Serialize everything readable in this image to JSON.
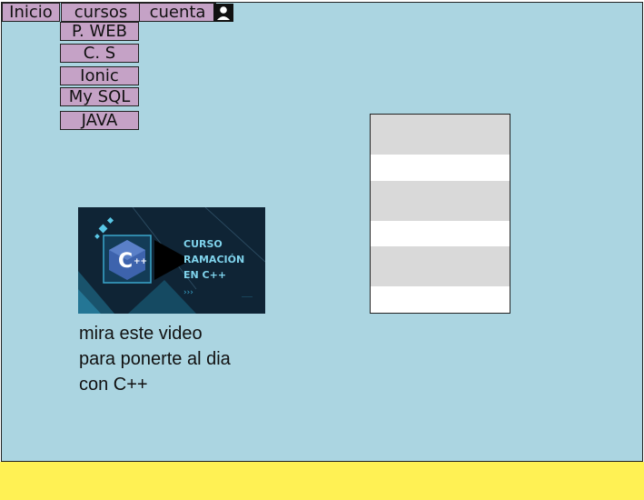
{
  "nav": {
    "items": [
      {
        "label": "Inicio"
      },
      {
        "label": "cursos"
      },
      {
        "label": "cuenta"
      }
    ]
  },
  "cursos_menu": {
    "items": [
      {
        "label": "P. WEB"
      },
      {
        "label": "C. S"
      },
      {
        "label": "Ionic"
      },
      {
        "label": "My SQL"
      },
      {
        "label": "JAVA"
      }
    ]
  },
  "video": {
    "line1": "CURSO",
    "line2": "RAMACIÓN",
    "line3": "EN C++",
    "logo_letter": "C",
    "logo_marks": "++"
  },
  "caption": {
    "line1": "mira este video",
    "line2": "para ponerte al dia",
    "line3": "con C++"
  },
  "table": {
    "rows": [
      {
        "shade": "#d9d9d9"
      },
      {
        "shade": "#ffffff"
      },
      {
        "shade": "#d9d9d9"
      },
      {
        "shade": "#ffffff"
      },
      {
        "shade": "#d9d9d9"
      },
      {
        "shade": "#ffffff"
      }
    ]
  },
  "colors": {
    "background": "#abd5e1",
    "menu": "#c5a2c6",
    "footer": "#fff154",
    "video_bg": "#0f2435",
    "video_accent": "#1d8cb0"
  },
  "icons": {
    "account": "user-icon",
    "play": "play-icon"
  }
}
